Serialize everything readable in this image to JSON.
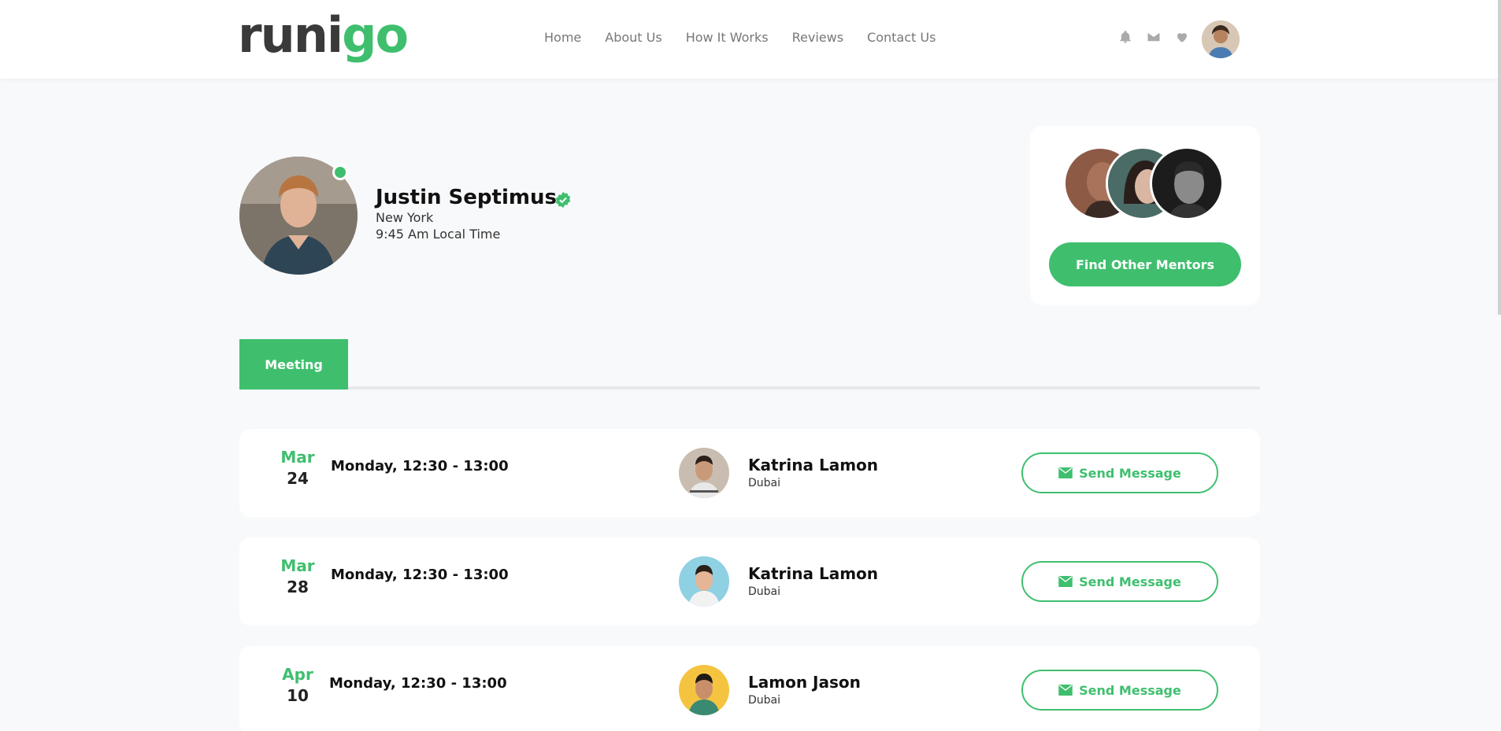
{
  "header": {
    "logo": {
      "part1": "runi",
      "part2": "go"
    },
    "nav": [
      "Home",
      "About Us",
      "How It Works",
      "Reviews",
      "Contact Us"
    ],
    "icons": [
      "bell-icon",
      "mail-icon",
      "heart-icon"
    ]
  },
  "profile": {
    "name": "Justin Septimus",
    "city": "New York",
    "local_time": "9:45 Am Local Time",
    "status": "online"
  },
  "mentors": {
    "button_label": "Find Other Mentors"
  },
  "tabs": [
    {
      "label": "Meeting",
      "active": true
    }
  ],
  "meetings": [
    {
      "month": "Mar",
      "day": "24",
      "time": "Monday, 12:30 - 13:00",
      "name": "Katrina Lamon",
      "city": "Dubai",
      "button": "Send Message"
    },
    {
      "month": "Mar",
      "day": "28",
      "time": "Monday, 12:30 - 13:00",
      "name": "Katrina Lamon",
      "city": "Dubai",
      "button": "Send Message"
    },
    {
      "month": "Apr",
      "day": "10",
      "time": "Monday, 12:30 - 13:00",
      "name": "Lamon Jason",
      "city": "Dubai",
      "button": "Send Message"
    }
  ],
  "colors": {
    "accent": "#3fbf6e",
    "background": "#f8f9fb"
  }
}
